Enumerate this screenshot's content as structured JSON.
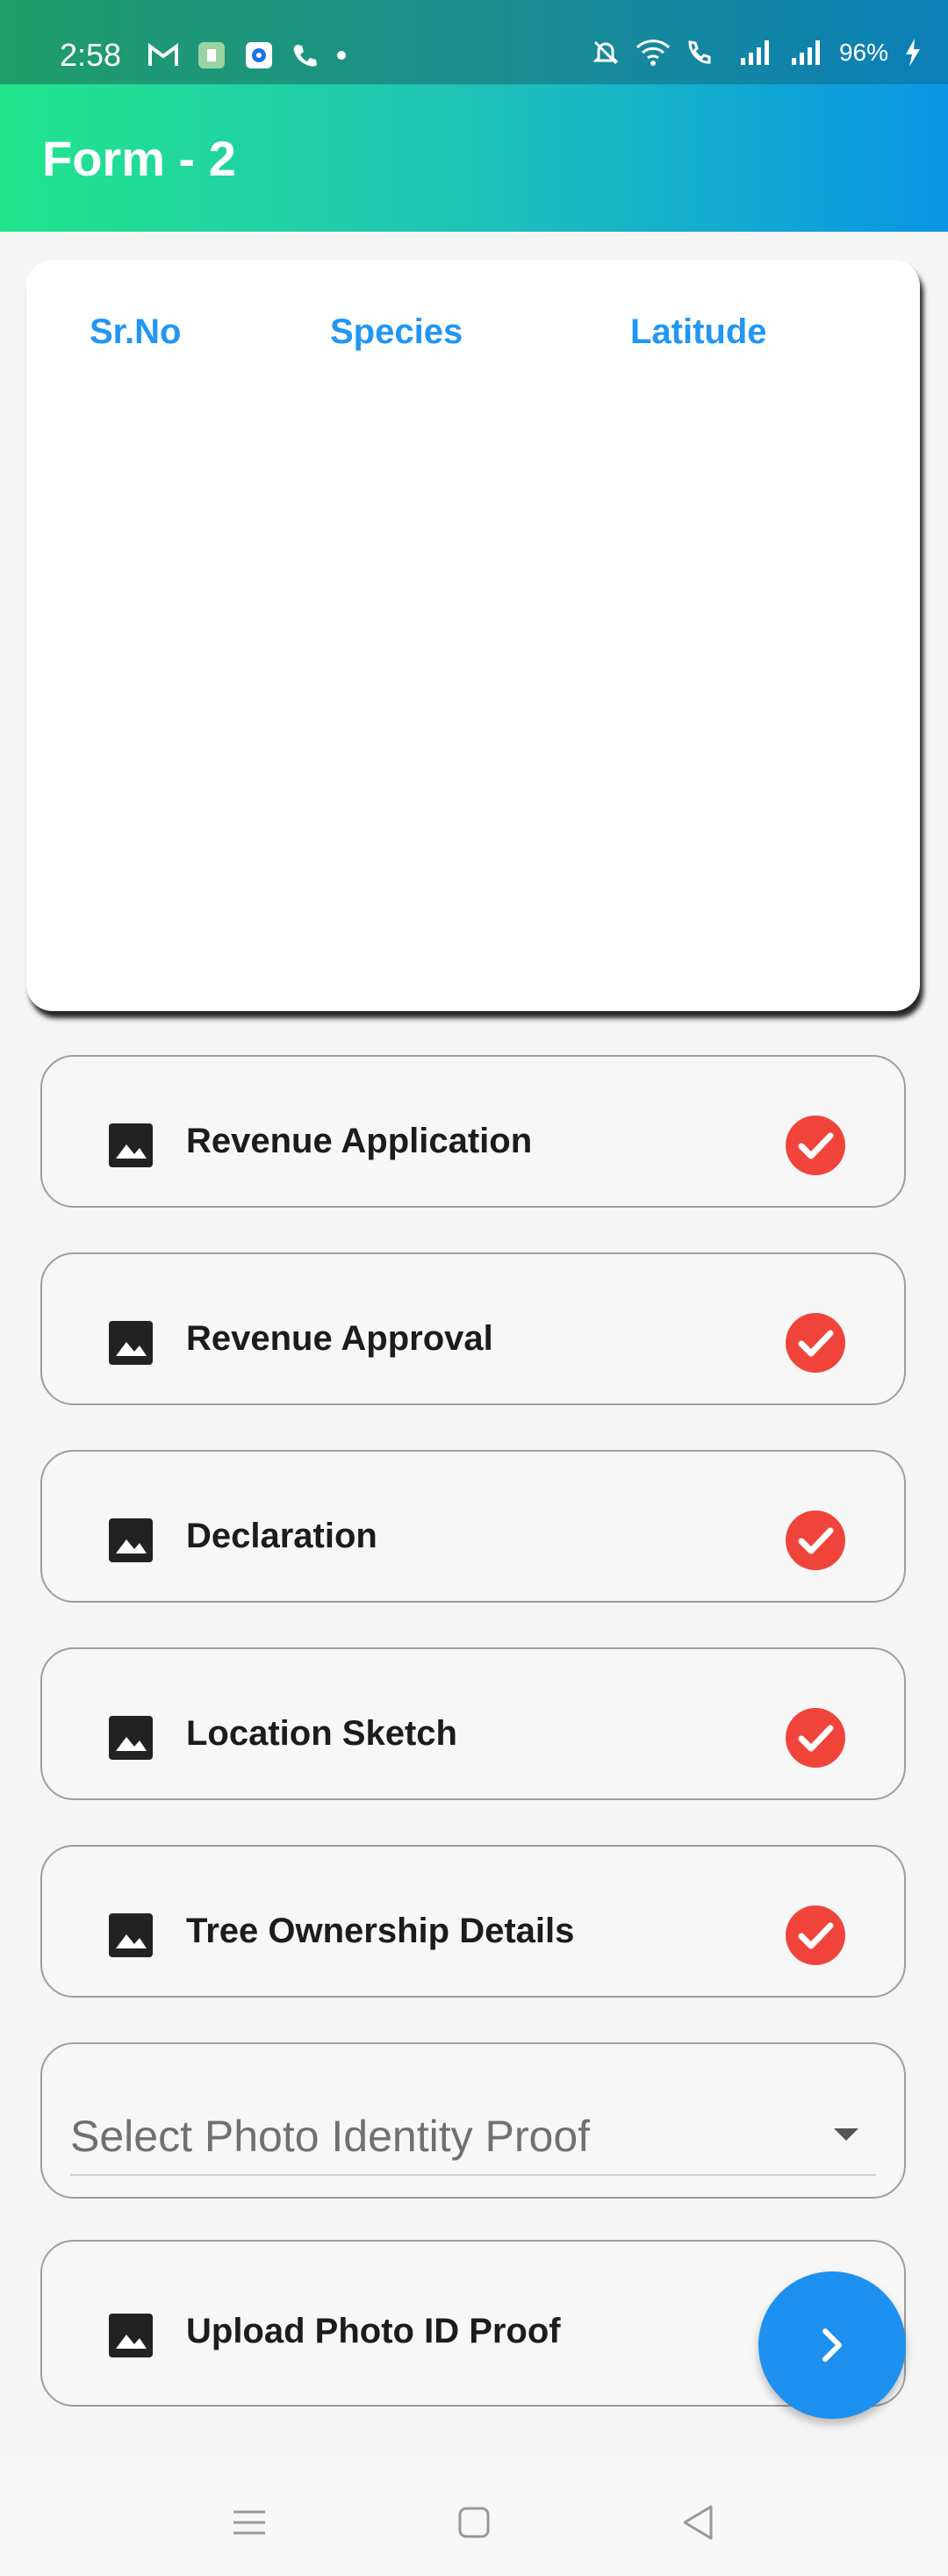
{
  "status_bar": {
    "time": "2:58",
    "battery": "96%",
    "left_icons": [
      "gmail-icon",
      "app-icon",
      "chrome-like-icon",
      "phone-icon",
      "dot-icon"
    ],
    "right_icons": [
      "mute-icon",
      "wifi-icon",
      "wifi-calling-icon",
      "signal-icon",
      "signal-icon",
      "charging-icon"
    ]
  },
  "app_bar": {
    "title": "Form - 2"
  },
  "table": {
    "headers": [
      "Sr.No",
      "Species",
      "Latitude"
    ],
    "header_color": "#2196f3",
    "rows": []
  },
  "documents": [
    {
      "label": "Revenue Application",
      "icon": "image-icon",
      "status_icon": "check-circle-icon"
    },
    {
      "label": "Revenue Approval",
      "icon": "image-icon",
      "status_icon": "check-circle-icon"
    },
    {
      "label": "Declaration",
      "icon": "image-icon",
      "status_icon": "check-circle-icon"
    },
    {
      "label": "Location Sketch",
      "icon": "image-icon",
      "status_icon": "check-circle-icon"
    },
    {
      "label": "Tree Ownership Details",
      "icon": "image-icon",
      "status_icon": "check-circle-icon"
    }
  ],
  "photo_id_dropdown": {
    "placeholder": "Select Photo Identity Proof",
    "icon": "chevron-down-icon"
  },
  "upload_photo_id": {
    "label": "Upload Photo ID Proof",
    "icon": "image-icon"
  },
  "fab": {
    "icon": "chevron-right-icon",
    "color": "#1e90f0"
  },
  "check_color": "#f0443a",
  "nav_bar": {
    "buttons": [
      "menu-icon",
      "home-icon",
      "back-icon"
    ]
  }
}
